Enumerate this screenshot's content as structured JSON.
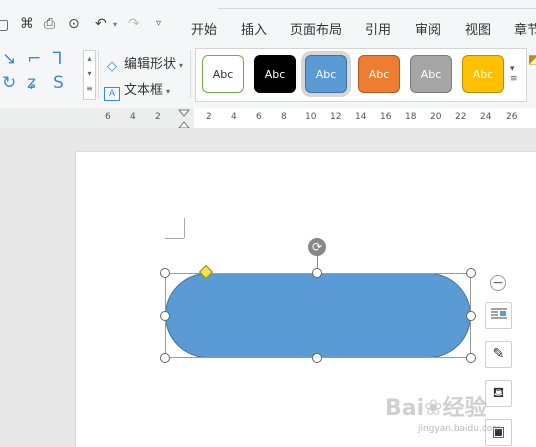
{
  "menu": [
    "开始",
    "插入",
    "页面布局",
    "引用",
    "审阅",
    "视图",
    "章节"
  ],
  "quick_icons": [
    "save-icon",
    "format-painter-icon",
    "print-icon",
    "print-preview-icon",
    "undo-icon",
    "redo-icon",
    "customize-icon"
  ],
  "ribbon": {
    "edit_shape": "编辑形状",
    "text_box": "文本框"
  },
  "style_swatches": [
    {
      "label": "Abc",
      "fill": "#ffffff",
      "border": "#70ad47",
      "text": "#333333"
    },
    {
      "label": "Abc",
      "fill": "#000000",
      "border": "#000000",
      "text": "#ffffff"
    },
    {
      "label": "Abc",
      "fill": "#5b9bd5",
      "border": "#41719c",
      "text": "#ffffff",
      "selected": true
    },
    {
      "label": "Abc",
      "fill": "#ed7d31",
      "border": "#ae5a21",
      "text": "#ffffff"
    },
    {
      "label": "Abc",
      "fill": "#a5a5a5",
      "border": "#7c7c7c",
      "text": "#ffffff"
    },
    {
      "label": "Abc",
      "fill": "#ffc000",
      "border": "#bc8c00",
      "text": "#ffffff"
    }
  ],
  "ruler_ticks": [
    "6",
    "4",
    "2",
    "2",
    "4",
    "6",
    "8",
    "10",
    "12",
    "14",
    "16",
    "18",
    "20",
    "22",
    "24",
    "26"
  ],
  "shape": {
    "fill": "#5b9bd5",
    "border": "#41719c"
  },
  "watermark": {
    "main": "Bai❀经验",
    "sub": "jingyan.baidu.com"
  }
}
